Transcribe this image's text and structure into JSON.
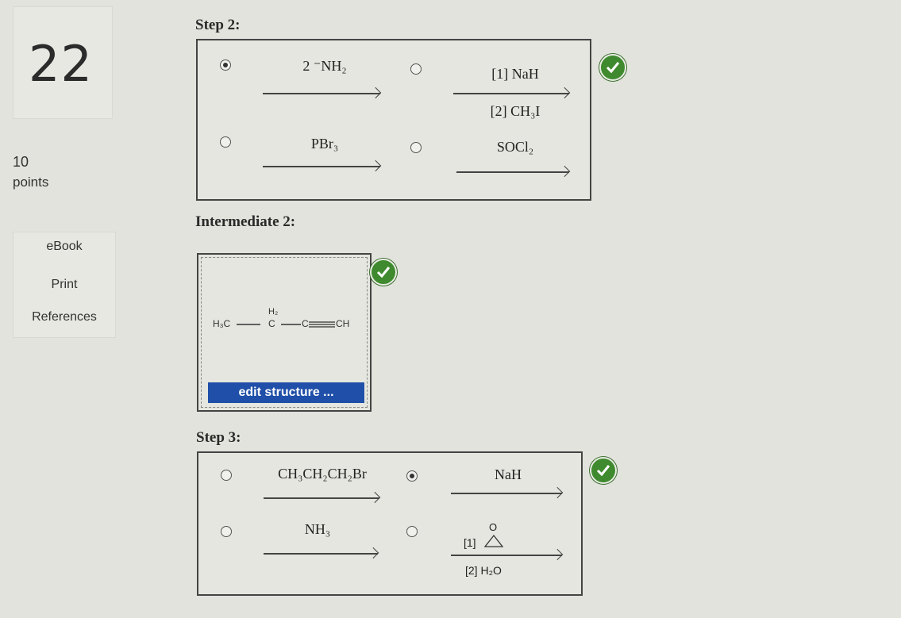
{
  "sidebar": {
    "question_number": "22",
    "points_value": "10",
    "points_label": "points",
    "menu": [
      {
        "label": "eBook"
      },
      {
        "label": "Print"
      },
      {
        "label": "References"
      }
    ]
  },
  "step2": {
    "label": "Step 2:",
    "options": [
      {
        "reagent_top": "2 ⁻NH₂",
        "reagent_bottom": "",
        "selected": true
      },
      {
        "reagent_top": "[1] NaH",
        "reagent_bottom": "[2] CH₃I",
        "selected": false
      },
      {
        "reagent_top": "PBr₃",
        "reagent_bottom": "",
        "selected": false
      },
      {
        "reagent_top": "SOCl₂",
        "reagent_bottom": "",
        "selected": false
      }
    ],
    "status": "correct"
  },
  "intermediate2": {
    "label": "Intermediate 2:",
    "structure_h3c": "H₃C",
    "structure_h2": "H₂",
    "structure_c": "C",
    "structure_c2": "C",
    "structure_ch": "CH",
    "edit_button": "edit structure ...",
    "status": "correct"
  },
  "step3": {
    "label": "Step 3:",
    "options": [
      {
        "reagent_top": "CH₃CH₂CH₂Br",
        "reagent_bottom": "",
        "selected": false
      },
      {
        "reagent_top": "NaH",
        "reagent_bottom": "",
        "selected": true
      },
      {
        "reagent_top": "NH₃",
        "reagent_bottom": "",
        "selected": false
      },
      {
        "reagent_top": "[1]",
        "reagent_epoxide_o": "O",
        "reagent_bottom": "[2] H₂O",
        "selected": false
      }
    ],
    "status": "correct"
  },
  "colors": {
    "background": "#e1e3dc",
    "check_green": "#3f8a2e",
    "edit_button_blue": "#1f4fa8"
  }
}
